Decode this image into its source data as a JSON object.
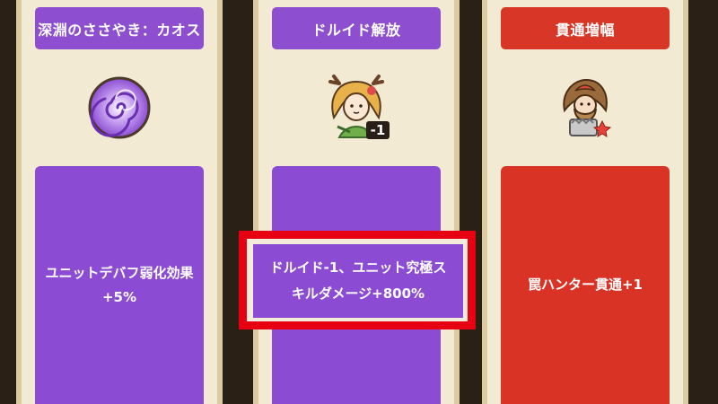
{
  "cards": [
    {
      "title": "深淵のささやき：カオス",
      "icon": "chaos-swirl-icon",
      "description": "ユニットデバフ弱化効果\n+5%",
      "color": "#8c4bd3"
    },
    {
      "title": "ドルイド解放",
      "icon": "druid-portrait-icon",
      "icon_badge": "-1",
      "description": "ドルイド-1、ユニット究極ス\nキルダメージ+800%",
      "color": "#8c4bd3",
      "highlighted": true,
      "highlight_color": "#e60012"
    },
    {
      "title": "貫通増幅",
      "icon": "trap-hunter-icon",
      "description": "罠ハンター貫通+1",
      "color": "#d93326"
    }
  ]
}
